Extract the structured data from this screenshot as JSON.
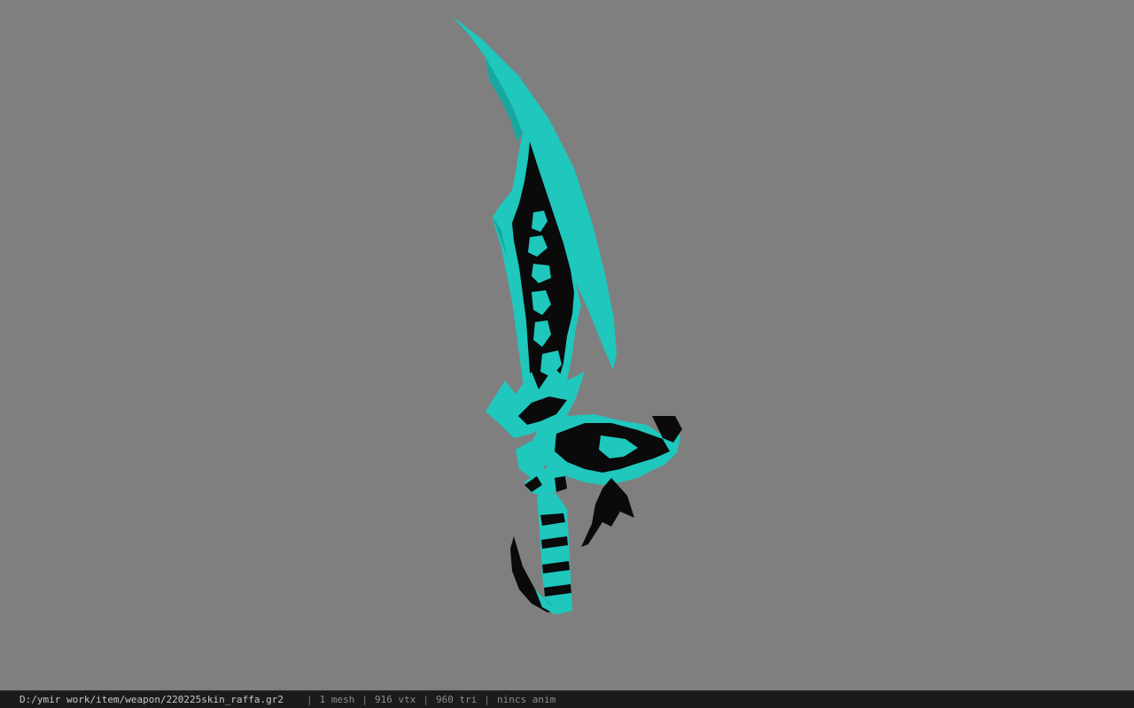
{
  "viewer": {
    "background_color": "#7f7f7f",
    "model": {
      "name": "sword-model",
      "primary_color": "#1fc7bd",
      "highlight_color": "#2fe0d4",
      "shadow_color": "#0e8f88",
      "dark_color": "#0a0a0a"
    }
  },
  "status_bar": {
    "file_path": "D:/ymir work/item/weapon/220225skin_raffa.gr2",
    "separator": "|",
    "mesh_count": "1 mesh",
    "vertex_count": "916 vtx",
    "triangle_count": "960 tri",
    "anim_status": "nincs anim"
  }
}
